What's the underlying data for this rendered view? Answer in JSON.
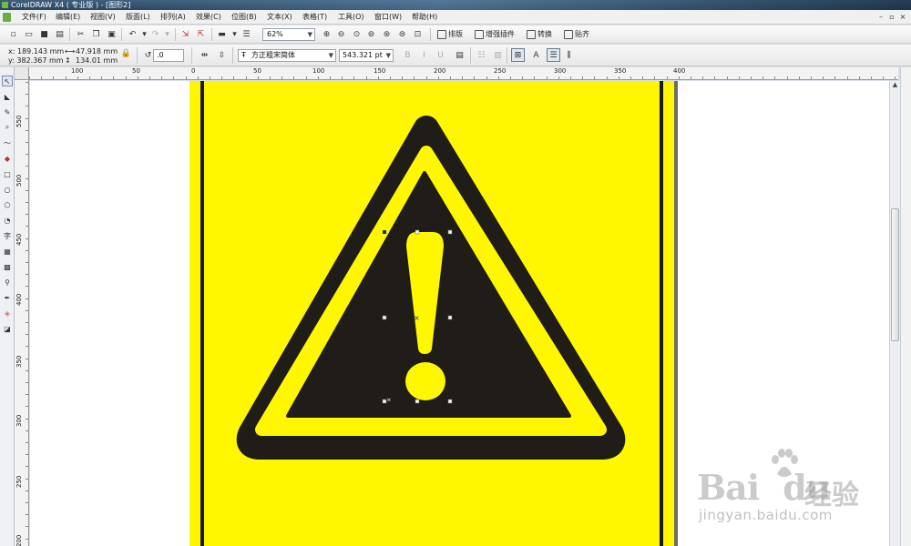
{
  "window": {
    "title": "CorelDRAW X4 ( 专业版 ) - [图形2]"
  },
  "menu": {
    "items": [
      "文件(F)",
      "编辑(E)",
      "视图(V)",
      "版面(L)",
      "排列(A)",
      "效果(C)",
      "位图(B)",
      "文本(X)",
      "表格(T)",
      "工具(O)",
      "窗口(W)",
      "帮助(H)"
    ]
  },
  "toolbar": {
    "zoom_value": "62%",
    "buttons": [
      "排版",
      "增强插件",
      "转换",
      "贴齐"
    ]
  },
  "property_bar": {
    "x": "x: 189.143 mm",
    "y": "y: 382.367 mm",
    "width": "47.918 mm",
    "height": "134.01 mm",
    "rotation": ".0",
    "font_name": "方正粗宋简体",
    "font_size": "543.321 pt"
  },
  "ruler": {
    "h_labels": [
      "100",
      "50",
      "0",
      "50",
      "100",
      "150",
      "200",
      "250",
      "300",
      "350",
      "400"
    ],
    "v_labels": [
      "550",
      "500",
      "450",
      "400",
      "350",
      "300",
      "250",
      "200"
    ]
  },
  "colors": {
    "page": "#fff700",
    "sign_dark": "#201d19",
    "title_bar": "#2b4560"
  },
  "watermark": {
    "brand": "Bai",
    "brand2": "du",
    "chinese": "经验",
    "url": "jingyan.baidu.com"
  },
  "icons": [
    "select-icon",
    "shape-icon",
    "crop-icon",
    "zoom-icon",
    "freehand-icon",
    "smart-fill-icon",
    "rectangle-icon",
    "ellipse-icon",
    "polygon-icon",
    "basic-shapes-icon",
    "text-icon",
    "table-icon",
    "interactive-blend-icon",
    "eyedropper-icon",
    "outline-icon",
    "fill-icon",
    "interactive-fill-icon"
  ]
}
